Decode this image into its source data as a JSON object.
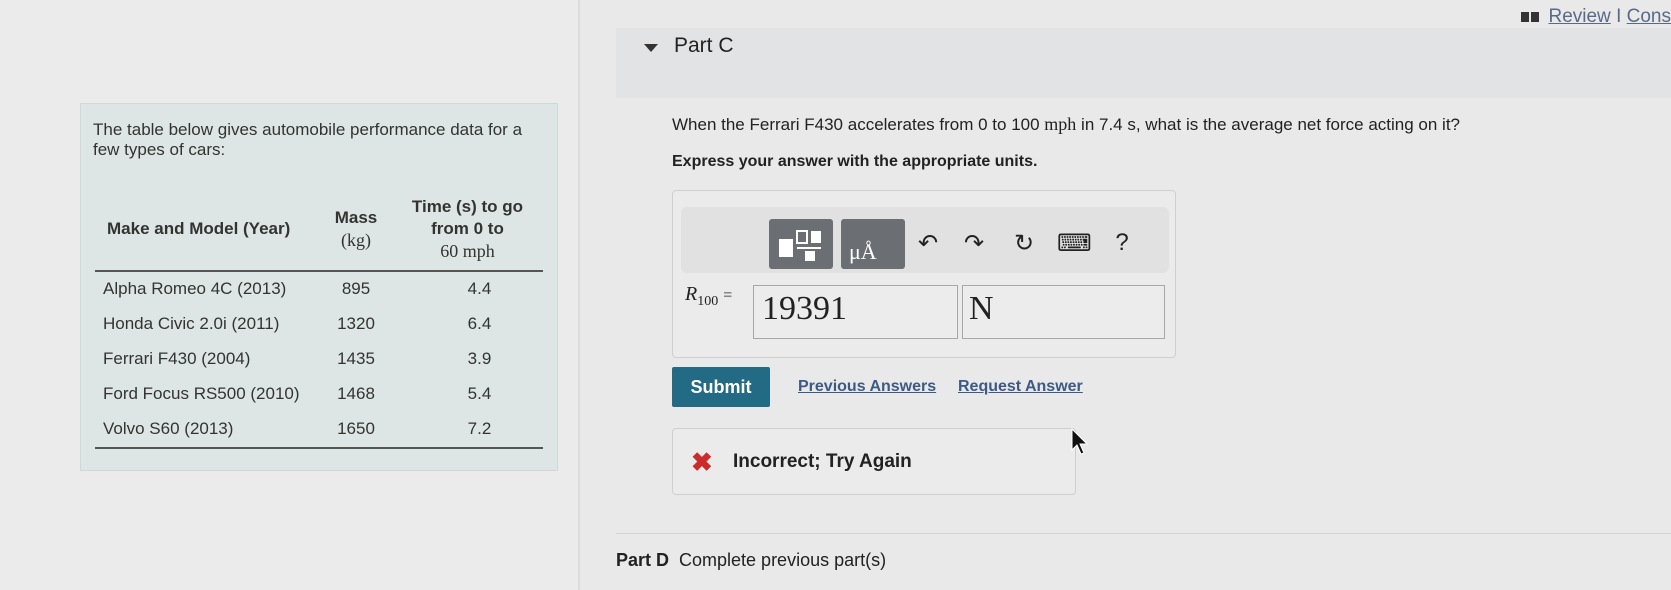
{
  "top_links": {
    "review": "Review",
    "separator": "I",
    "constants": "Cons"
  },
  "info": {
    "intro": "The table below gives automobile performance data for a few types of cars:",
    "headers": {
      "model": "Make and Model (Year)",
      "mass_line1": "Mass",
      "mass_unit": "(kg)",
      "time_line1": "Time (s) to go",
      "time_line2": "from 0 to",
      "time_unit": "60 mph"
    },
    "rows": [
      {
        "model": "Alpha Romeo 4C (2013)",
        "mass": "895",
        "time": "4.4"
      },
      {
        "model": "Honda Civic 2.0i (2011)",
        "mass": "1320",
        "time": "6.4"
      },
      {
        "model": "Ferrari F430 (2004)",
        "mass": "1435",
        "time": "3.9"
      },
      {
        "model": "Ford Focus RS500 (2010)",
        "mass": "1468",
        "time": "5.4"
      },
      {
        "model": "Volvo S60 (2013)",
        "mass": "1650",
        "time": "7.2"
      }
    ]
  },
  "part_c": {
    "title": "Part C",
    "question_pre": "When the Ferrari F430 accelerates from 0 to 100 ",
    "question_unit": "mph",
    "question_mid": " in 7.4 ",
    "question_s": "s",
    "question_post": ", what is the average net force acting on it?",
    "instruction": "Express your answer with the appropriate units.",
    "toolbar": {
      "templates_icon": "fraction-template-icon",
      "units_icon": "units-icon",
      "units_label": "μÅ",
      "undo": "↶",
      "redo": "↷",
      "reset": "↻",
      "keyboard": "⌨",
      "help": "?"
    },
    "equation_var": "R",
    "equation_sub": "100",
    "equals": "=",
    "answer_value": "19391",
    "answer_unit": "N",
    "submit_label": "Submit",
    "previous_answers": "Previous Answers",
    "request_answer": "Request Answer",
    "feedback_icon": "✖",
    "feedback": "Incorrect; Try Again"
  },
  "part_d": {
    "label": "Part D",
    "text": "Complete previous part(s)"
  },
  "colors": {
    "submit": "#236a84",
    "error": "#cc2b2b",
    "link": "#3d5a85",
    "info_bg": "#dde6e4"
  }
}
